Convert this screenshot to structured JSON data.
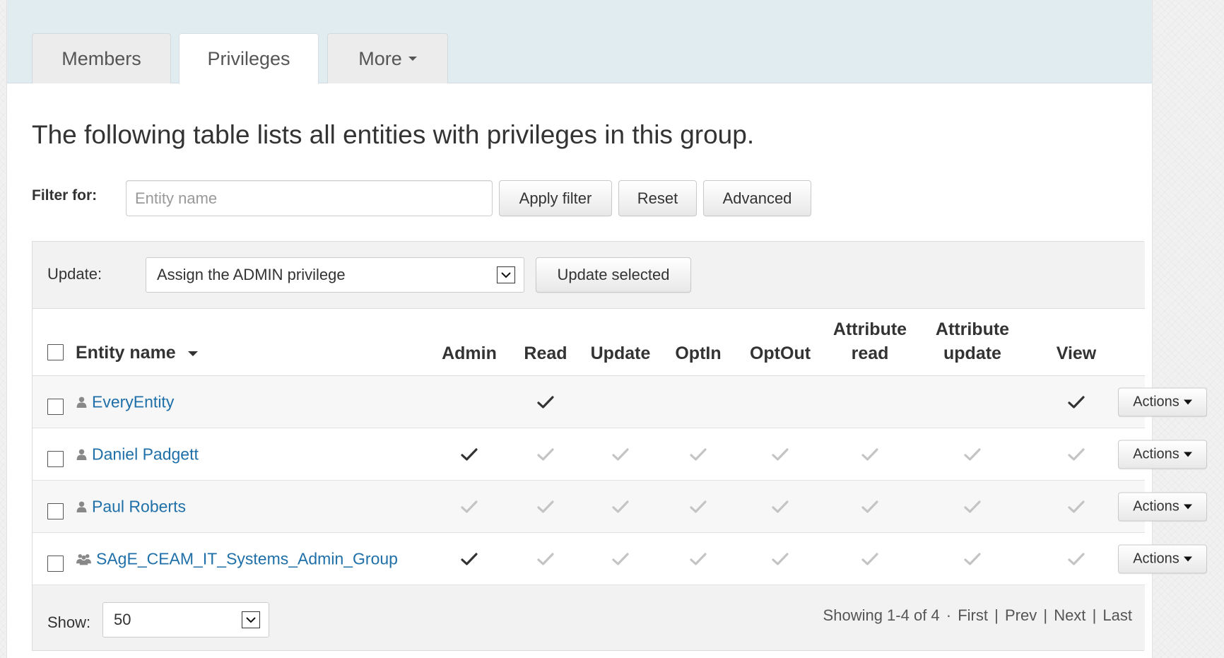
{
  "tabs": [
    {
      "label": "Members",
      "active": false
    },
    {
      "label": "Privileges",
      "active": true
    },
    {
      "label": "More",
      "active": false,
      "dropdown": true
    }
  ],
  "intro_text": "The following table lists all entities with privileges in this group.",
  "filter": {
    "label": "Filter for:",
    "placeholder": "Entity name",
    "value": "",
    "apply_label": "Apply filter",
    "reset_label": "Reset",
    "advanced_label": "Advanced"
  },
  "update_bar": {
    "label": "Update:",
    "selected": "Assign the ADMIN privilege",
    "button_label": "Update selected"
  },
  "table": {
    "name_header": "Entity name",
    "columns": [
      {
        "key": "admin",
        "line1": "",
        "line2": "Admin"
      },
      {
        "key": "read",
        "line1": "",
        "line2": "Read"
      },
      {
        "key": "update",
        "line1": "",
        "line2": "Update"
      },
      {
        "key": "optin",
        "line1": "",
        "line2": "OptIn"
      },
      {
        "key": "optout",
        "line1": "",
        "line2": "OptOut"
      },
      {
        "key": "attr_read",
        "line1": "Attribute",
        "line2": "read"
      },
      {
        "key": "attr_update",
        "line1": "Attribute",
        "line2": "update"
      },
      {
        "key": "view",
        "line1": "",
        "line2": "View"
      }
    ],
    "rows": [
      {
        "name": "EveryEntity",
        "icon": "user-icon",
        "privileges": [
          "none",
          "assigned",
          "none",
          "none",
          "none",
          "none",
          "none",
          "assigned"
        ]
      },
      {
        "name": "Daniel Padgett",
        "icon": "user-icon",
        "privileges": [
          "assigned",
          "inherited",
          "inherited",
          "inherited",
          "inherited",
          "inherited",
          "inherited",
          "inherited"
        ]
      },
      {
        "name": "Paul Roberts",
        "icon": "user-icon",
        "privileges": [
          "inherited",
          "inherited",
          "inherited",
          "inherited",
          "inherited",
          "inherited",
          "inherited",
          "inherited"
        ]
      },
      {
        "name": "SAgE_CEAM_IT_Systems_Admin_Group",
        "icon": "group-icon",
        "privileges": [
          "assigned",
          "inherited",
          "inherited",
          "inherited",
          "inherited",
          "inherited",
          "inherited",
          "inherited"
        ]
      }
    ],
    "actions_label": "Actions"
  },
  "footer": {
    "show_label": "Show:",
    "page_size": "50",
    "showing_text": "Showing 1-4 of 4",
    "separator": "·",
    "first": "First",
    "prev": "Prev",
    "next": "Next",
    "last": "Last"
  },
  "colors": {
    "link": "#1f6fa8",
    "tabbar_bg": "#e1ecf0",
    "check_assigned": "#333333",
    "check_inherited": "#c4c4c4"
  }
}
